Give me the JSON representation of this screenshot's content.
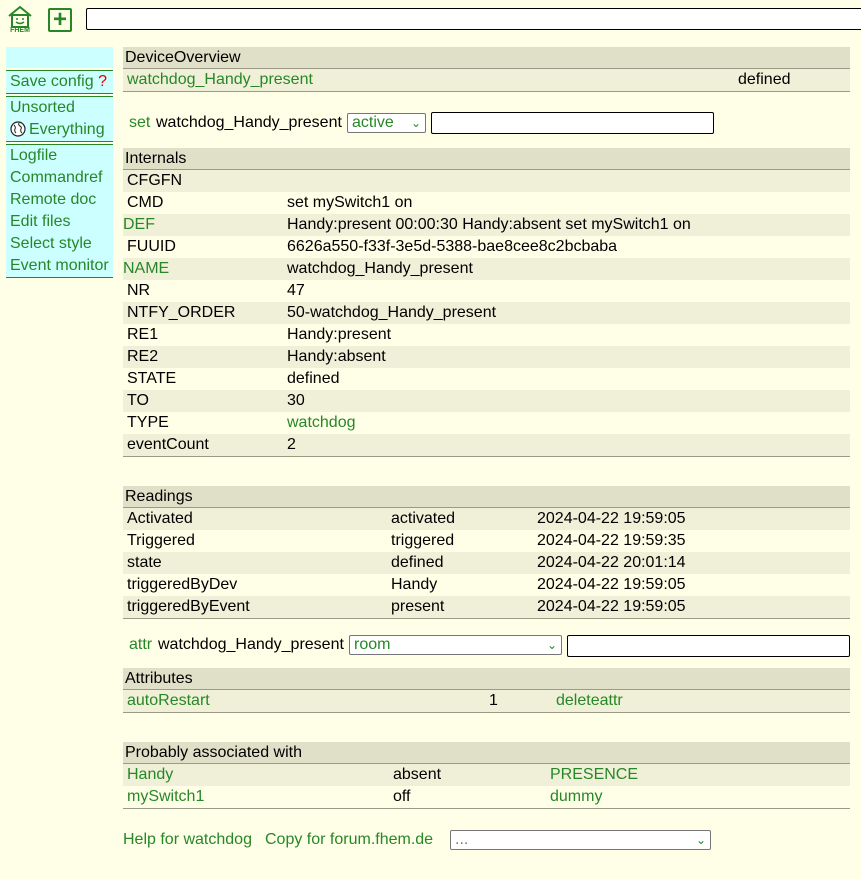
{
  "topbar": {
    "logo_text": "FHEM",
    "add_icon": "plus-icon",
    "command_value": ""
  },
  "menu": {
    "save_config": "Save config",
    "save_config_q": "?",
    "rooms": [
      "Unsorted",
      "Everything"
    ],
    "everything_icon": "globe-icon",
    "tools": [
      "Logfile",
      "Commandref",
      "Remote doc",
      "Edit files",
      "Select style",
      "Event monitor"
    ]
  },
  "overview": {
    "title": "DeviceOverview",
    "device": "watchdog_Handy_present",
    "state": "defined"
  },
  "set": {
    "label": "set",
    "device": "watchdog_Handy_present",
    "selected": "active",
    "value": ""
  },
  "internals": {
    "title": "Internals",
    "rows": [
      {
        "name": "CFGFN",
        "value": "",
        "name_link": false,
        "value_link": false
      },
      {
        "name": "CMD",
        "value": "set mySwitch1 on",
        "name_link": false,
        "value_link": false
      },
      {
        "name": "DEF",
        "value": "Handy:present 00:00:30 Handy:absent set mySwitch1 on",
        "name_link": true,
        "value_link": false
      },
      {
        "name": "FUUID",
        "value": "6626a550-f33f-3e5d-5388-bae8cee8c2bcbaba",
        "name_link": false,
        "value_link": false
      },
      {
        "name": "NAME",
        "value": "watchdog_Handy_present",
        "name_link": true,
        "value_link": false
      },
      {
        "name": "NR",
        "value": "47",
        "name_link": false,
        "value_link": false
      },
      {
        "name": "NTFY_ORDER",
        "value": "50-watchdog_Handy_present",
        "name_link": false,
        "value_link": false
      },
      {
        "name": "RE1",
        "value": "Handy:present",
        "name_link": false,
        "value_link": false
      },
      {
        "name": "RE2",
        "value": "Handy:absent",
        "name_link": false,
        "value_link": false
      },
      {
        "name": "STATE",
        "value": "defined",
        "name_link": false,
        "value_link": false
      },
      {
        "name": "TO",
        "value": "30",
        "name_link": false,
        "value_link": false
      },
      {
        "name": "TYPE",
        "value": "watchdog",
        "name_link": false,
        "value_link": true
      },
      {
        "name": "eventCount",
        "value": "2",
        "name_link": false,
        "value_link": false
      }
    ]
  },
  "readings": {
    "title": "Readings",
    "rows": [
      {
        "name": "Activated",
        "value": "activated",
        "time": "2024-04-22 19:59:05"
      },
      {
        "name": "Triggered",
        "value": "triggered",
        "time": "2024-04-22 19:59:35"
      },
      {
        "name": "state",
        "value": "defined",
        "time": "2024-04-22 20:01:14"
      },
      {
        "name": "triggeredByDev",
        "value": "Handy",
        "time": "2024-04-22 19:59:05"
      },
      {
        "name": "triggeredByEvent",
        "value": "present",
        "time": "2024-04-22 19:59:05"
      }
    ]
  },
  "attr": {
    "label": "attr",
    "device": "watchdog_Handy_present",
    "selected": "room",
    "value": ""
  },
  "attributes": {
    "title": "Attributes",
    "rows": [
      {
        "name": "autoRestart",
        "value": "1",
        "action": "deleteattr"
      }
    ]
  },
  "associated": {
    "title": "Probably associated with",
    "rows": [
      {
        "name": "Handy",
        "state": "absent",
        "type": "PRESENCE"
      },
      {
        "name": "mySwitch1",
        "state": "off",
        "type": "dummy"
      }
    ]
  },
  "footer": {
    "help": "Help for watchdog",
    "copy": "Copy for forum.fhem.de",
    "select_value": "..."
  }
}
